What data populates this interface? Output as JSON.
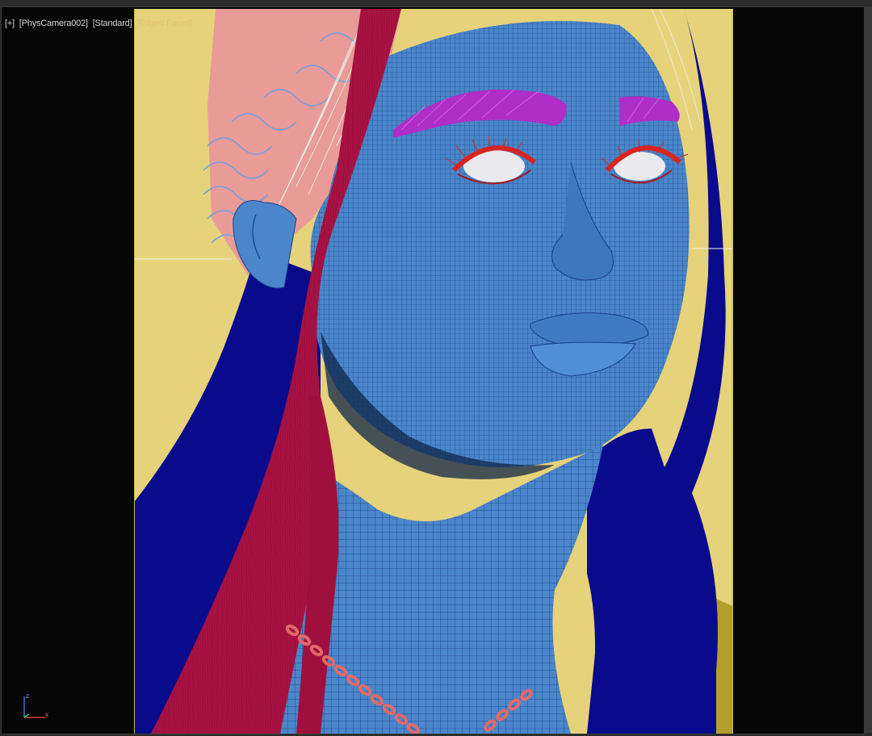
{
  "viewport": {
    "labels": {
      "plus": "[+]",
      "camera": "[PhysCamera002]",
      "shading": "[Standard]",
      "edged": "[Edged Faces]"
    },
    "axis": {
      "x": "x",
      "z": "z"
    }
  },
  "colors": {
    "background": "#e6d27a",
    "skin": "#4a86c9",
    "hair_red": "#a0103e",
    "hair_blue": "#0a0a8c",
    "eyebrows": "#b02ec8",
    "eyelashes": "#d9241e",
    "scalp": "#e99b97",
    "chain": "#e06a6a"
  }
}
